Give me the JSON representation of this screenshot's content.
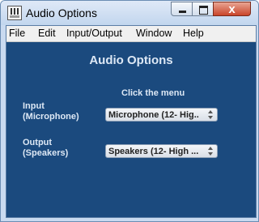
{
  "window": {
    "title": "Audio Options",
    "icon": "audio-app-icon",
    "controls": {
      "minimize": "minimize-icon",
      "maximize": "maximize-icon",
      "close": "close-icon",
      "close_glyph": "x"
    }
  },
  "menubar": {
    "items": [
      {
        "label": "File"
      },
      {
        "label": "Edit"
      },
      {
        "label": "Input/Output"
      },
      {
        "label": "Window"
      },
      {
        "label": "Help"
      }
    ]
  },
  "main": {
    "heading": "Audio Options",
    "hint": "Click the menu",
    "input": {
      "label_line1": "Input",
      "label_line2": "(Microphone)",
      "selected_value": "Microphone (12- Hig..."
    },
    "output": {
      "label_line1": "Output",
      "label_line2": "(Speakers)",
      "selected_value": "Speakers (12- High ..."
    }
  },
  "colors": {
    "panel_background": "#1b4a7e",
    "title_bar": "#c2d6ee",
    "menubar": "#f0f0f0",
    "label_text": "#dde8f5",
    "close_button": "#c9452a"
  }
}
